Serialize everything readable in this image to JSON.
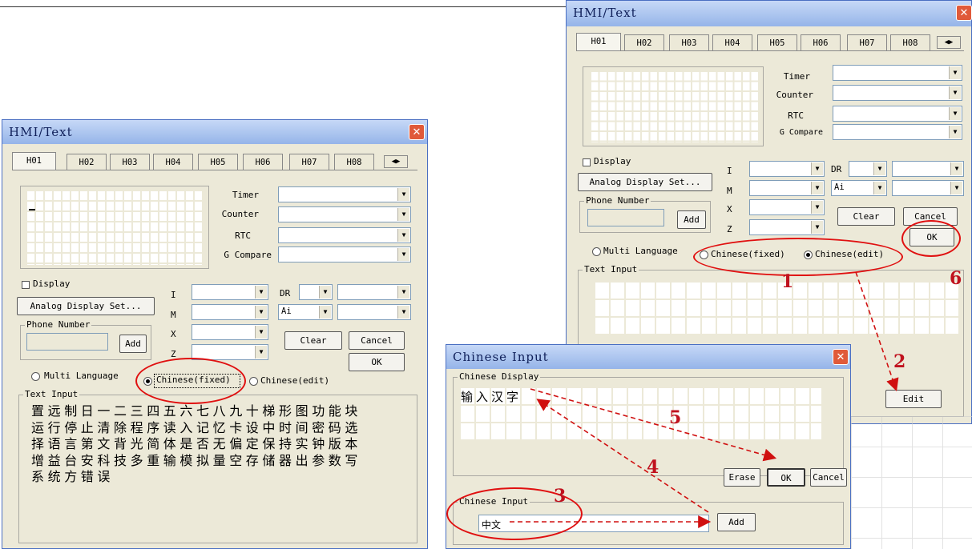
{
  "dialogs": {
    "left": {
      "title": "HMI/Text",
      "tabs": [
        "H01",
        "H02",
        "H03",
        "H04",
        "H05",
        "H06",
        "H07",
        "H08"
      ],
      "timer_label": "Timer",
      "counter_label": "Counter",
      "rtc_label": "RTC",
      "gcompare_label": "G Compare",
      "display_label": "Display",
      "analog_button": "Analog Display Set...",
      "phone_label": "Phone Number",
      "add_button": "Add",
      "i_label": "I",
      "m_label": "M",
      "x_label": "X",
      "z_label": "Z",
      "dr_label": "DR",
      "ai_value": "Ai",
      "clear_button": "Clear",
      "cancel_button": "Cancel",
      "ok_button": "OK",
      "radio_multi": "Multi Language",
      "radio_fixed": "Chinese(fixed)",
      "radio_edit": "Chinese(edit)",
      "text_input_label": "Text Input",
      "char_lines": [
        "置远制日一二三四五六七八九十梯形图功能块",
        "运行停止清除程序读入记忆卡设中时间密码选",
        "择语言第文背光简体是否无偏定保持实钟版本",
        "增益台安科技多重输模拟量空存储器出参数写",
        "系统方错误"
      ]
    },
    "right": {
      "title": "HMI/Text",
      "tabs": [
        "H01",
        "H02",
        "H03",
        "H04",
        "H05",
        "H06",
        "H07",
        "H08"
      ],
      "timer_label": "Timer",
      "counter_label": "Counter",
      "rtc_label": "RTC",
      "gcompare_label": "G Compare",
      "display_label": "Display",
      "analog_button": "Analog Display Set...",
      "phone_label": "Phone Number",
      "add_button": "Add",
      "i_label": "I",
      "m_label": "M",
      "x_label": "X",
      "z_label": "Z",
      "dr_label": "DR",
      "ai_value": "Ai",
      "clear_button": "Clear",
      "cancel_button": "Cancel",
      "ok_button": "OK",
      "radio_multi": "Multi Language",
      "radio_fixed": "Chinese(fixed)",
      "radio_edit": "Chinese(edit)",
      "text_input_label": "Text Input",
      "edit_button": "Edit"
    },
    "chinese_input": {
      "title": "Chinese Input",
      "display_group": "Chinese Display",
      "display_text": "输入汉字",
      "erase_button": "Erase",
      "ok_button": "OK",
      "cancel_button": "Cancel",
      "input_group": "Chinese Input",
      "input_value": "中文",
      "add_button": "Add"
    }
  },
  "annotations": {
    "step_numbers": [
      "1",
      "2",
      "3",
      "4",
      "5",
      "6"
    ],
    "color": "#d01010"
  }
}
